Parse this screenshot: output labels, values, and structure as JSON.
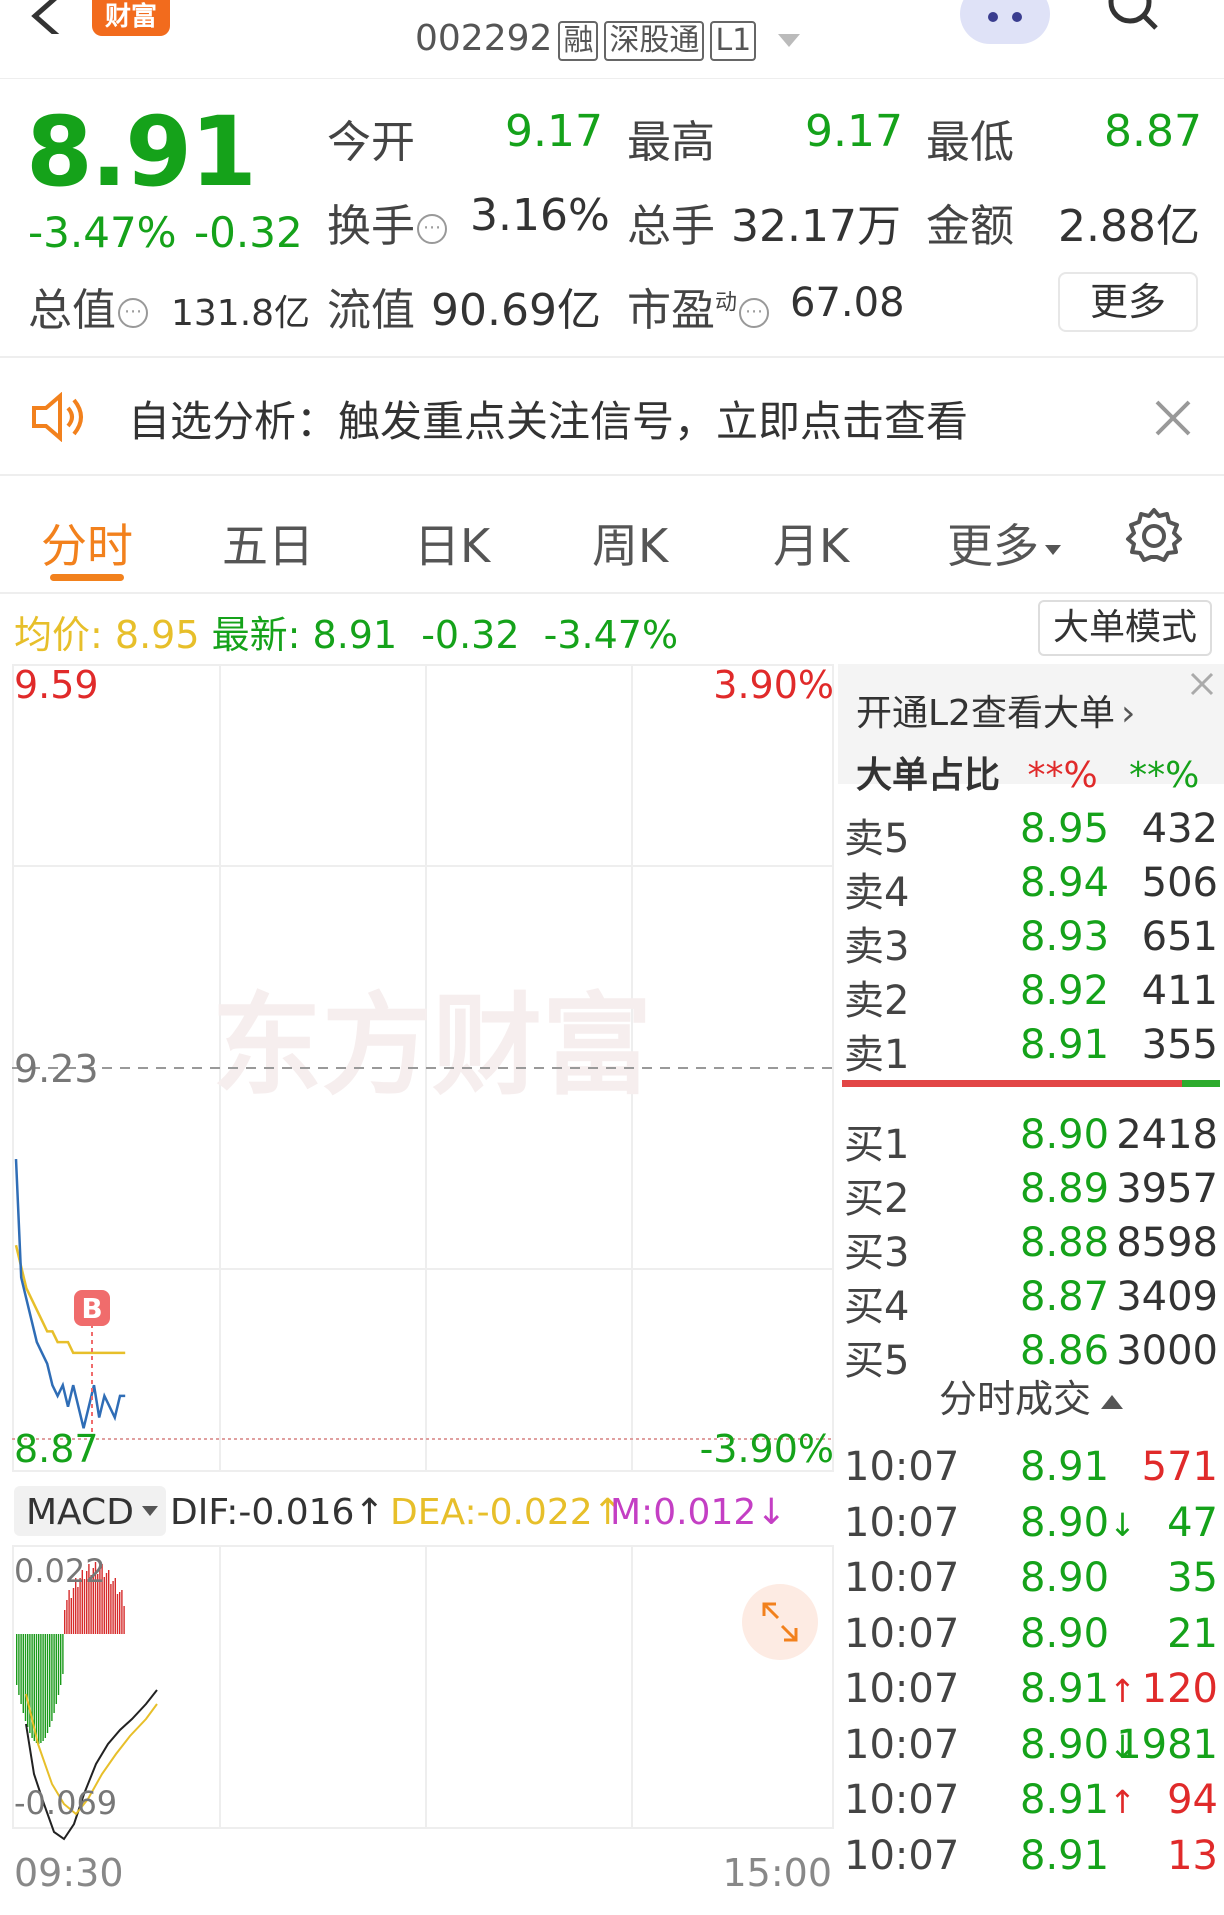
{
  "header": {
    "badge": "财富",
    "code": "002292",
    "tags": [
      "融",
      "深股通",
      "L1"
    ]
  },
  "quote": {
    "price": "8.91",
    "change_pct": "-3.47%",
    "change": "-0.32",
    "open_label": "今开",
    "open": "9.17",
    "high_label": "最高",
    "high": "9.17",
    "low_label": "最低",
    "low": "8.87",
    "turnover_label": "换手",
    "turnover": "3.16%",
    "volume_label": "总手",
    "volume": "32.17万",
    "amount_label": "金额",
    "amount": "2.88亿",
    "mktcap_label": "总值",
    "mktcap": "131.8亿",
    "float_label": "流值",
    "float": "90.69亿",
    "pe_label": "市盈",
    "pe_sup": "动",
    "pe": "67.08",
    "more": "更多"
  },
  "alert": {
    "text": "自选分析：触发重点关注信号，立即点击查看"
  },
  "tabs": [
    "分时",
    "五日",
    "日K",
    "周K",
    "月K",
    "更多"
  ],
  "price_row": {
    "avg_label": "均价:",
    "avg": "8.95",
    "latest_label": "最新:",
    "latest": "8.91",
    "chg": "-0.32",
    "pct": "-3.47%",
    "mode_button": "大单模式"
  },
  "chart": {
    "y_top": "9.59",
    "y_mid": "9.23",
    "y_bot": "8.87",
    "pct_top": "3.90%",
    "pct_bot": "-3.90%",
    "watermark": "东方财富",
    "marker": "B",
    "macd_label": "MACD",
    "dif": "DIF:-0.016↑",
    "dea": "DEA:-0.022↑",
    "m": "M:0.012↓",
    "macd_top": "0.022",
    "macd_bot": "-0.069",
    "time_start": "09:30",
    "time_end": "15:00"
  },
  "chart_data": {
    "type": "line",
    "series": [
      {
        "name": "",
        "values": [
          9.13,
          9.02,
          9.0,
          8.98,
          8.96,
          8.95,
          8.94,
          8.92,
          8.91,
          8.92,
          8.9,
          8.92,
          8.9,
          8.88,
          8.9,
          8.92,
          8.89,
          8.91,
          8.9,
          8.89,
          8.91,
          8.91
        ]
      },
      {
        "name": "",
        "values": [
          9.05,
          9.03,
          9.01,
          9.0,
          8.99,
          8.98,
          8.97,
          8.97,
          8.96,
          8.96,
          8.96,
          8.95,
          8.95,
          8.95,
          8.95,
          8.95,
          8.95,
          8.95,
          8.95,
          8.95,
          8.95,
          8.95
        ]
      }
    ],
    "ylim": [
      8.87,
      9.59
    ],
    "grid": true
  },
  "side": {
    "l2_link": "开通L2查看大单",
    "ratio_label": "大单占比",
    "ratio1": "**%",
    "ratio2": "**%",
    "asks": [
      {
        "label": "卖5",
        "price": "8.95",
        "vol": "432"
      },
      {
        "label": "卖4",
        "price": "8.94",
        "vol": "506"
      },
      {
        "label": "卖3",
        "price": "8.93",
        "vol": "651"
      },
      {
        "label": "卖2",
        "price": "8.92",
        "vol": "411"
      },
      {
        "label": "卖1",
        "price": "8.91",
        "vol": "355"
      }
    ],
    "bids": [
      {
        "label": "买1",
        "price": "8.90",
        "vol": "2418"
      },
      {
        "label": "买2",
        "price": "8.89",
        "vol": "3957"
      },
      {
        "label": "买3",
        "price": "8.88",
        "vol": "8598"
      },
      {
        "label": "买4",
        "price": "8.87",
        "vol": "3409"
      },
      {
        "label": "买5",
        "price": "8.86",
        "vol": "3000"
      }
    ],
    "trades_title": "分时成交",
    "trades": [
      {
        "time": "10:07",
        "price": "8.91",
        "arrow": "",
        "vol": "571",
        "side": "buy"
      },
      {
        "time": "10:07",
        "price": "8.90",
        "arrow": "↓",
        "vol": "47",
        "side": "sell"
      },
      {
        "time": "10:07",
        "price": "8.90",
        "arrow": "",
        "vol": "35",
        "side": "sell"
      },
      {
        "time": "10:07",
        "price": "8.90",
        "arrow": "",
        "vol": "21",
        "side": "sell"
      },
      {
        "time": "10:07",
        "price": "8.91",
        "arrow": "↑",
        "vol": "120",
        "side": "buy"
      },
      {
        "time": "10:07",
        "price": "8.90",
        "arrow": "↓",
        "vol": "1981",
        "side": "sell"
      },
      {
        "time": "10:07",
        "price": "8.91",
        "arrow": "↑",
        "vol": "94",
        "side": "buy"
      },
      {
        "time": "10:07",
        "price": "8.91",
        "arrow": "",
        "vol": "13",
        "side": "buy"
      }
    ]
  },
  "colors": {
    "up": "#e02a2a",
    "down": "#15a21a",
    "accent": "#f2811d",
    "line": "#2f6db6",
    "avg": "#e7bf2a"
  }
}
